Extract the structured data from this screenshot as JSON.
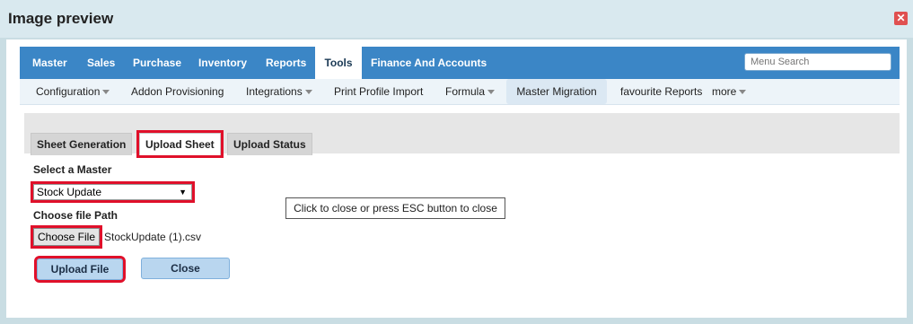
{
  "dialog": {
    "title": "Image preview",
    "close_icon": "close-icon"
  },
  "menu": {
    "items": [
      "Master",
      "Sales",
      "Purchase",
      "Inventory",
      "Reports",
      "Tools",
      "Finance And Accounts"
    ],
    "active": "Tools",
    "search_placeholder": "Menu Search",
    "bar_color": "#3b86c6"
  },
  "submenu": {
    "items": [
      "Configuration",
      "Addon Provisioning",
      "Integrations",
      "Print Profile Import",
      "Formula",
      "Master Migration",
      "favourite Reports",
      "more"
    ],
    "selected": "Master Migration"
  },
  "tabs": {
    "items": [
      "Sheet Generation",
      "Upload Sheet",
      "Upload Status"
    ],
    "active": "Upload Sheet"
  },
  "form": {
    "select_master_label": "Select a Master",
    "master_value": "Stock Update",
    "file_path_label": "Choose file Path",
    "choose_file_label": "Choose File",
    "file_name": "StockUpdate (1).csv",
    "upload_label": "Upload File",
    "close_label": "Close"
  },
  "tooltip": "Click to close or press ESC button to close",
  "highlight_color": "#e0102a"
}
